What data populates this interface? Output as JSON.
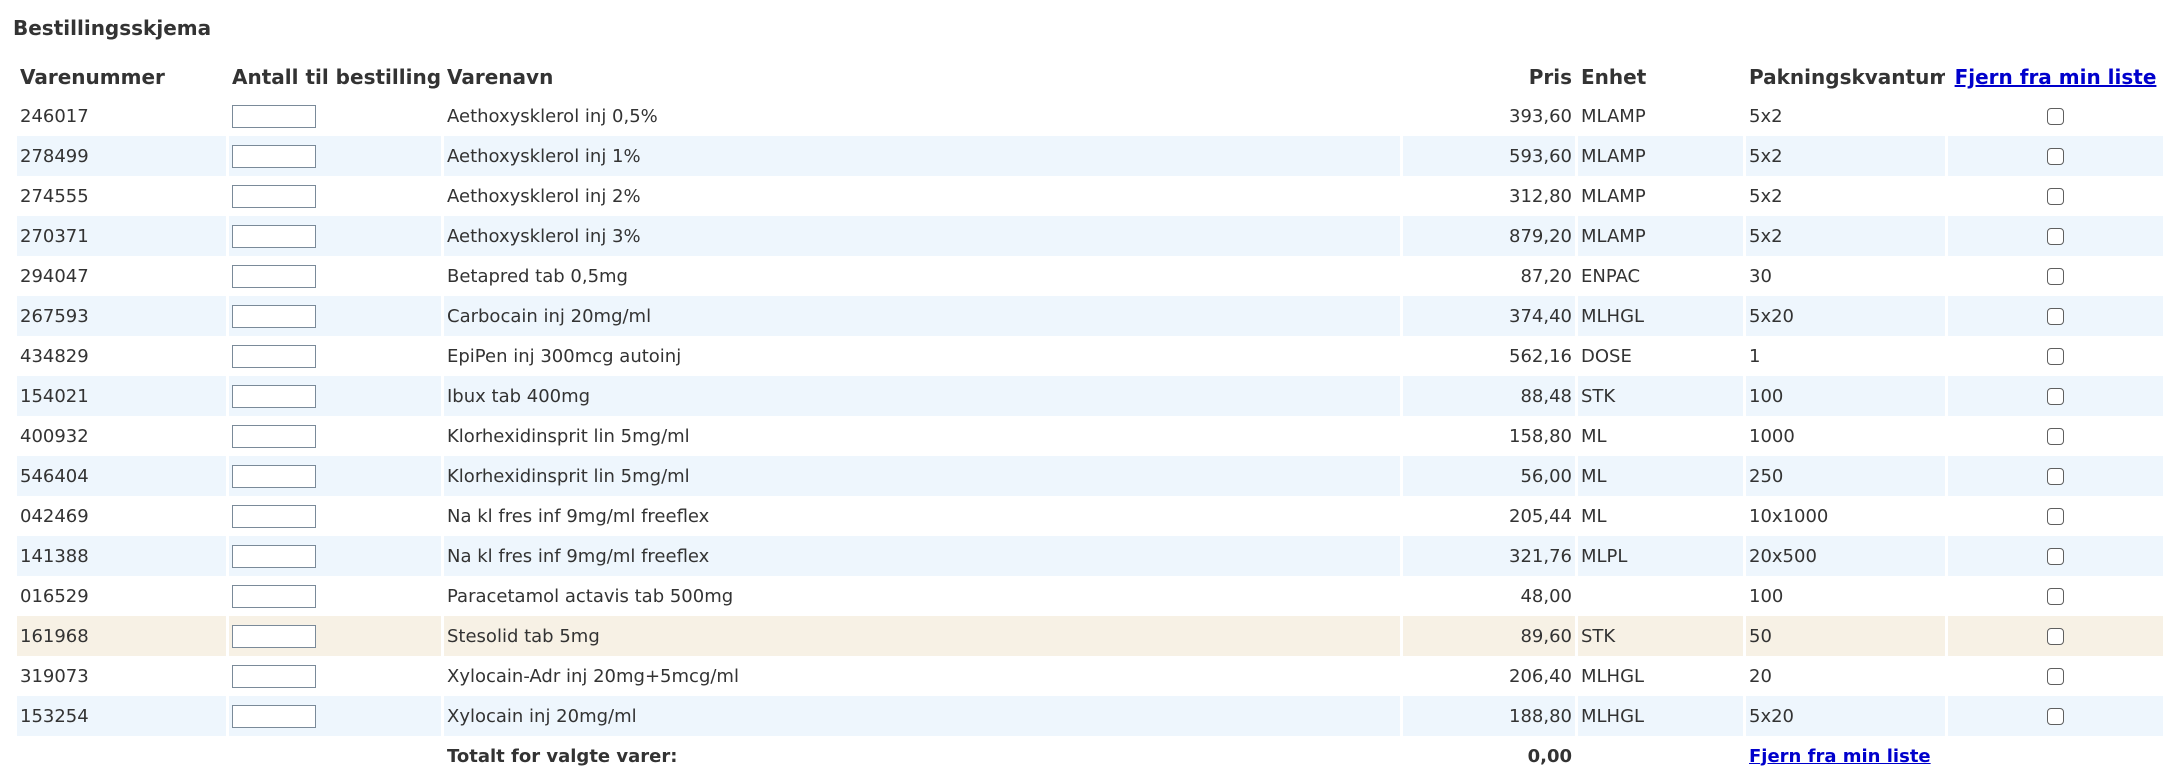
{
  "page": {
    "title": "Bestillingsskjema"
  },
  "headers": {
    "item_number": "Varenummer",
    "quantity": "Antall til bestilling",
    "name": "Varenavn",
    "price": "Pris",
    "unit": "Enhet",
    "pack_qty": "Pakningskvantum",
    "remove_link": "Fjern fra min liste"
  },
  "rows": [
    {
      "item_number": "246017",
      "quantity": "",
      "name": "Aethoxysklerol inj 0,5%",
      "price": "393,60",
      "unit": "MLAMP",
      "pack_qty": "5x2",
      "remove": false
    },
    {
      "item_number": "278499",
      "quantity": "",
      "name": "Aethoxysklerol inj 1%",
      "price": "593,60",
      "unit": "MLAMP",
      "pack_qty": "5x2",
      "remove": false
    },
    {
      "item_number": "274555",
      "quantity": "",
      "name": "Aethoxysklerol inj 2%",
      "price": "312,80",
      "unit": "MLAMP",
      "pack_qty": "5x2",
      "remove": false
    },
    {
      "item_number": "270371",
      "quantity": "",
      "name": "Aethoxysklerol inj 3%",
      "price": "879,20",
      "unit": "MLAMP",
      "pack_qty": "5x2",
      "remove": false
    },
    {
      "item_number": "294047",
      "quantity": "",
      "name": "Betapred tab 0,5mg",
      "price": "87,20",
      "unit": "ENPAC",
      "pack_qty": "30",
      "remove": false
    },
    {
      "item_number": "267593",
      "quantity": "",
      "name": "Carbocain inj 20mg/ml",
      "price": "374,40",
      "unit": "MLHGL",
      "pack_qty": "5x20",
      "remove": false
    },
    {
      "item_number": "434829",
      "quantity": "",
      "name": "EpiPen inj 300mcg autoinj",
      "price": "562,16",
      "unit": "DOSE",
      "pack_qty": "1",
      "remove": false
    },
    {
      "item_number": "154021",
      "quantity": "",
      "name": "Ibux tab 400mg",
      "price": "88,48",
      "unit": "STK",
      "pack_qty": "100",
      "remove": false
    },
    {
      "item_number": "400932",
      "quantity": "",
      "name": "Klorhexidinsprit lin 5mg/ml",
      "price": "158,80",
      "unit": "ML",
      "pack_qty": "1000",
      "remove": false
    },
    {
      "item_number": "546404",
      "quantity": "",
      "name": "Klorhexidinsprit lin 5mg/ml",
      "price": "56,00",
      "unit": "ML",
      "pack_qty": "250",
      "remove": false
    },
    {
      "item_number": "042469",
      "quantity": "",
      "name": "Na kl fres inf 9mg/ml freeflex",
      "price": "205,44",
      "unit": "ML",
      "pack_qty": "10x1000",
      "remove": false
    },
    {
      "item_number": "141388",
      "quantity": "",
      "name": "Na kl fres inf 9mg/ml freeflex",
      "price": "321,76",
      "unit": "MLPL",
      "pack_qty": "20x500",
      "remove": false
    },
    {
      "item_number": "016529",
      "quantity": "",
      "name": "Paracetamol actavis tab 500mg",
      "price": "48,00",
      "unit": "",
      "pack_qty": "100",
      "remove": false
    },
    {
      "item_number": "161968",
      "quantity": "",
      "name": "Stesolid tab 5mg",
      "price": "89,60",
      "unit": "STK",
      "pack_qty": "50",
      "remove": false
    },
    {
      "item_number": "319073",
      "quantity": "",
      "name": "Xylocain-Adr inj 20mg+5mcg/ml",
      "price": "206,40",
      "unit": "MLHGL",
      "pack_qty": "20",
      "remove": false
    },
    {
      "item_number": "153254",
      "quantity": "",
      "name": "Xylocain inj 20mg/ml",
      "price": "188,80",
      "unit": "MLHGL",
      "pack_qty": "5x20",
      "remove": false
    }
  ],
  "highlighted_row": 13,
  "footer": {
    "total_label": "Totalt for valgte varer:",
    "total_value": "0,00",
    "remove_link": "Fjern fra min liste"
  },
  "colors": {
    "row_alt": "#eef6fd",
    "row_highlight": "#f7f1e5",
    "link": "#0000cc",
    "text": "#333333"
  }
}
